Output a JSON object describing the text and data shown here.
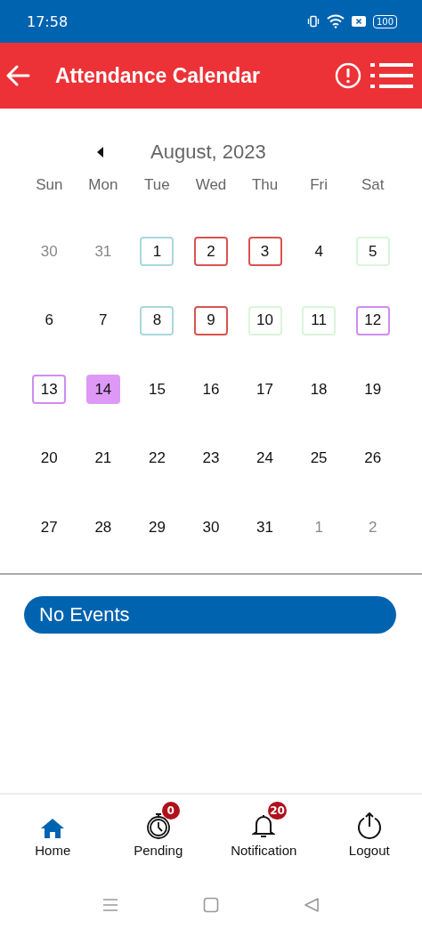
{
  "status_bar": {
    "time": "17:58",
    "battery": "100"
  },
  "header": {
    "title": "Attendance Calendar"
  },
  "calendar": {
    "month": "August, 2023",
    "weekdays": [
      "Sun",
      "Mon",
      "Tue",
      "Wed",
      "Thu",
      "Fri",
      "Sat"
    ],
    "weeks": [
      [
        {
          "day": "30",
          "outside": true,
          "selected": false
        },
        {
          "day": "31",
          "outside": true,
          "selected": false
        },
        {
          "day": "1",
          "outside": false,
          "selected": false,
          "color": "#a8d8dc"
        },
        {
          "day": "2",
          "outside": false,
          "selected": false,
          "color": "#d9534f"
        },
        {
          "day": "3",
          "outside": false,
          "selected": false,
          "color": "#d9534f"
        },
        {
          "day": "4",
          "outside": false,
          "selected": false
        },
        {
          "day": "5",
          "outside": false,
          "selected": false,
          "color": "#d8f5d8"
        }
      ],
      [
        {
          "day": "6",
          "outside": false,
          "selected": false
        },
        {
          "day": "7",
          "outside": false,
          "selected": false
        },
        {
          "day": "8",
          "outside": false,
          "selected": false,
          "color": "#a8d8dc"
        },
        {
          "day": "9",
          "outside": false,
          "selected": false,
          "color": "#d9534f"
        },
        {
          "day": "10",
          "outside": false,
          "selected": false,
          "color": "#d8f5d8"
        },
        {
          "day": "11",
          "outside": false,
          "selected": false,
          "color": "#d8f5d8"
        },
        {
          "day": "12",
          "outside": false,
          "selected": false,
          "color": "#d08cf0"
        }
      ],
      [
        {
          "day": "13",
          "outside": false,
          "selected": false,
          "color": "#d08cf0"
        },
        {
          "day": "14",
          "outside": false,
          "selected": true
        },
        {
          "day": "15",
          "outside": false,
          "selected": false
        },
        {
          "day": "16",
          "outside": false,
          "selected": false
        },
        {
          "day": "17",
          "outside": false,
          "selected": false
        },
        {
          "day": "18",
          "outside": false,
          "selected": false
        },
        {
          "day": "19",
          "outside": false,
          "selected": false
        }
      ],
      [
        {
          "day": "20",
          "outside": false,
          "selected": false
        },
        {
          "day": "21",
          "outside": false,
          "selected": false
        },
        {
          "day": "22",
          "outside": false,
          "selected": false
        },
        {
          "day": "23",
          "outside": false,
          "selected": false
        },
        {
          "day": "24",
          "outside": false,
          "selected": false
        },
        {
          "day": "25",
          "outside": false,
          "selected": false
        },
        {
          "day": "26",
          "outside": false,
          "selected": false
        }
      ],
      [
        {
          "day": "27",
          "outside": false,
          "selected": false
        },
        {
          "day": "28",
          "outside": false,
          "selected": false
        },
        {
          "day": "29",
          "outside": false,
          "selected": false
        },
        {
          "day": "30",
          "outside": false,
          "selected": false
        },
        {
          "day": "31",
          "outside": false,
          "selected": false
        },
        {
          "day": "1",
          "outside": true,
          "selected": false
        },
        {
          "day": "2",
          "outside": true,
          "selected": false
        }
      ]
    ]
  },
  "events": {
    "label": "No Events"
  },
  "bottom_nav": [
    {
      "kind": "home",
      "label": "Home",
      "selected": true
    },
    {
      "kind": "timer",
      "label": "Pending",
      "selected": false,
      "badge": "0"
    },
    {
      "kind": "bell",
      "label": "Notification",
      "selected": false,
      "badge": "20"
    },
    {
      "kind": "power",
      "label": "Logout",
      "selected": false
    }
  ]
}
